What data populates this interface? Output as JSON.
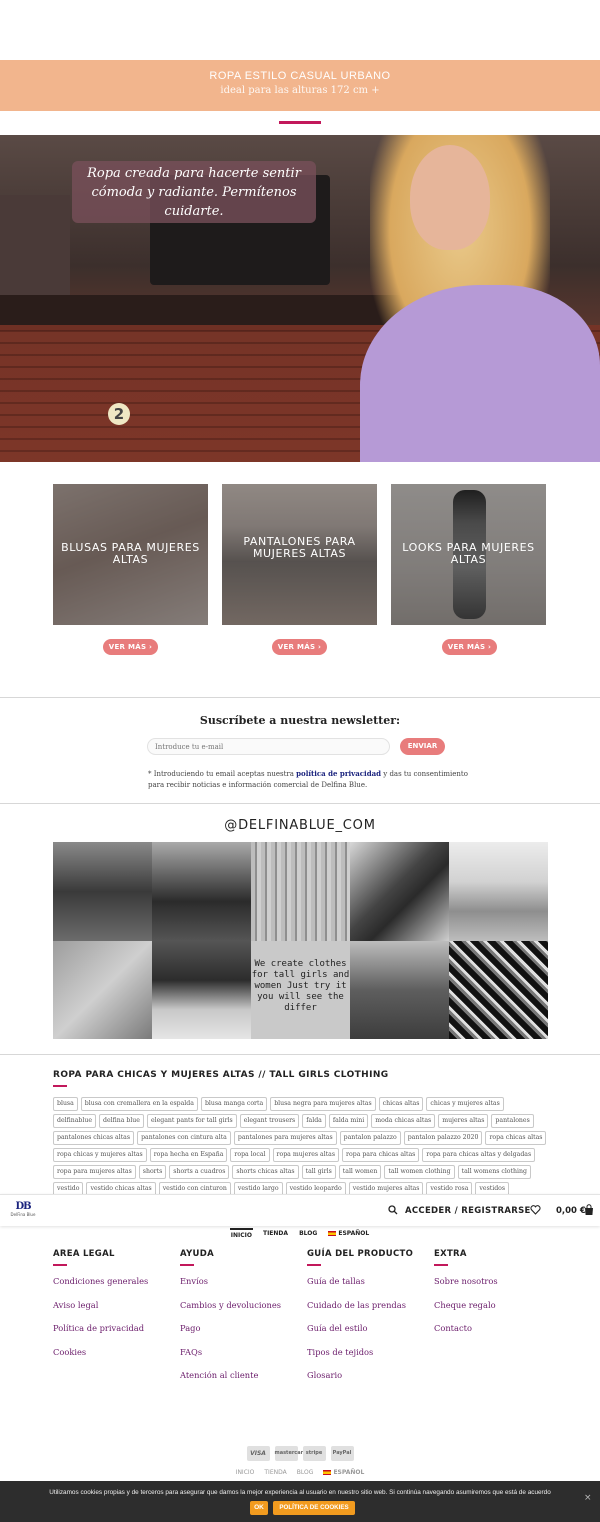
{
  "promo": {
    "line1": "ROPA ESTILO CASUAL URBANO",
    "line2": "ideal para las alturas 172 cm +"
  },
  "hero": {
    "quote": "Ropa creada para hacerte sentir cómoda y radiante. Permítenos cuidarte.",
    "sign_number": "2"
  },
  "categories": [
    {
      "title": "BLUSAS PARA MUJERES ALTAS",
      "button": "VER MÁS ›"
    },
    {
      "title": "PANTALONES PARA MUJERES ALTAS",
      "button": "VER MÁS ›"
    },
    {
      "title": "LOOKS PARA MUJERES ALTAS",
      "button": "VER MÁS ›"
    }
  ],
  "newsletter": {
    "title": "Suscríbete a nuestra newsletter:",
    "placeholder": "Introduce tu e-mail",
    "button": "ENVIAR",
    "note_prefix": "* Introduciendo tu email aceptas nuestra",
    "note_link": "política de privacidad",
    "note_suffix": "y das tu consentimiento para recibir noticias e información comercial de Delfina Blue."
  },
  "instagram": {
    "handle": "@DELFINABLUE_COM",
    "overlay_text": "We create clothes for tall girls and women Just try it you will see the differ"
  },
  "tags": {
    "title": "ROPA PARA CHICAS Y MUJERES ALTAS // TALL GIRLS CLOTHING",
    "items": [
      "blusa",
      "blusa con cremallera en la espalda",
      "blusa manga corta",
      "blusa negra para mujeres altas",
      "chicas altas",
      "chicas y mujeres altas",
      "delfinablue",
      "delfina blue",
      "elegant pants for tall girls",
      "elegant trousers",
      "falda",
      "falda mini",
      "moda chicas altas",
      "mujeres altas",
      "pantalones",
      "pantalones chicas altas",
      "pantalones con cintura alta",
      "pantalones para mujeres altas",
      "pantalon palazzo",
      "pantalon palazzo 2020",
      "ropa chicas altas",
      "ropa chicas y mujeres altas",
      "ropa hecha en España",
      "ropa local",
      "ropa mujeres altas",
      "ropa para chicas altas",
      "ropa para chicas altas y delgadas",
      "ropa para mujeres altas",
      "shorts",
      "shorts a cuadros",
      "shorts chicas altas",
      "tall girls",
      "tall women",
      "tall women clothing",
      "tall womens clothing",
      "vestido",
      "vestido chicas altas",
      "vestido con cinturon",
      "vestido largo",
      "vestido leopardo",
      "vestido mujeres altas",
      "vestido rosa",
      "vestidos"
    ]
  },
  "header": {
    "logo_mark": "DB",
    "logo_name": "DelFina Blue",
    "account": "ACCEDER / REGISTRARSE",
    "cart": "0,00 €",
    "nav": [
      "INICIO",
      "TIENDA",
      "BLOG",
      "ESPAÑOL"
    ]
  },
  "footer": {
    "columns": [
      {
        "title": "AREA LEGAL",
        "links": [
          "Condiciones generales",
          "Aviso legal",
          "Política de privacidad",
          "Cookies"
        ]
      },
      {
        "title": "AYUDA",
        "links": [
          "Envíos",
          "Cambios y devoluciones",
          "Pago",
          "FAQs",
          "Atención al cliente"
        ]
      },
      {
        "title": "GUÍA DEL PRODUCTO",
        "links": [
          "Guía de tallas",
          "Cuidado de las prendas",
          "Guía del estilo",
          "Tipos de tejidos",
          "Glosario"
        ]
      },
      {
        "title": "EXTRA",
        "links": [
          "Sobre nosotros",
          "Cheque regalo",
          "Contacto"
        ]
      }
    ],
    "payments": [
      "VISA",
      "mastercard",
      "stripe",
      "PayPal"
    ],
    "nav": [
      "INICIO",
      "TIENDA",
      "BLOG",
      "ESPAÑOL"
    ]
  },
  "cookie": {
    "text": "Utilizamos cookies propias y de terceros para asegurar que damos la mejor experiencia al usuario en nuestro sitio web. Si continúa navegando asumiremos que está de acuerdo",
    "ok": "OK",
    "policy": "POLÍTICA DE COOKIES",
    "close": "×"
  },
  "colors": {
    "promo_bg": "#f2b58d",
    "accent": "#c2185b",
    "button": "#e87c7c",
    "link": "#6a1b6a",
    "cookie_btn": "#f29b1f"
  }
}
